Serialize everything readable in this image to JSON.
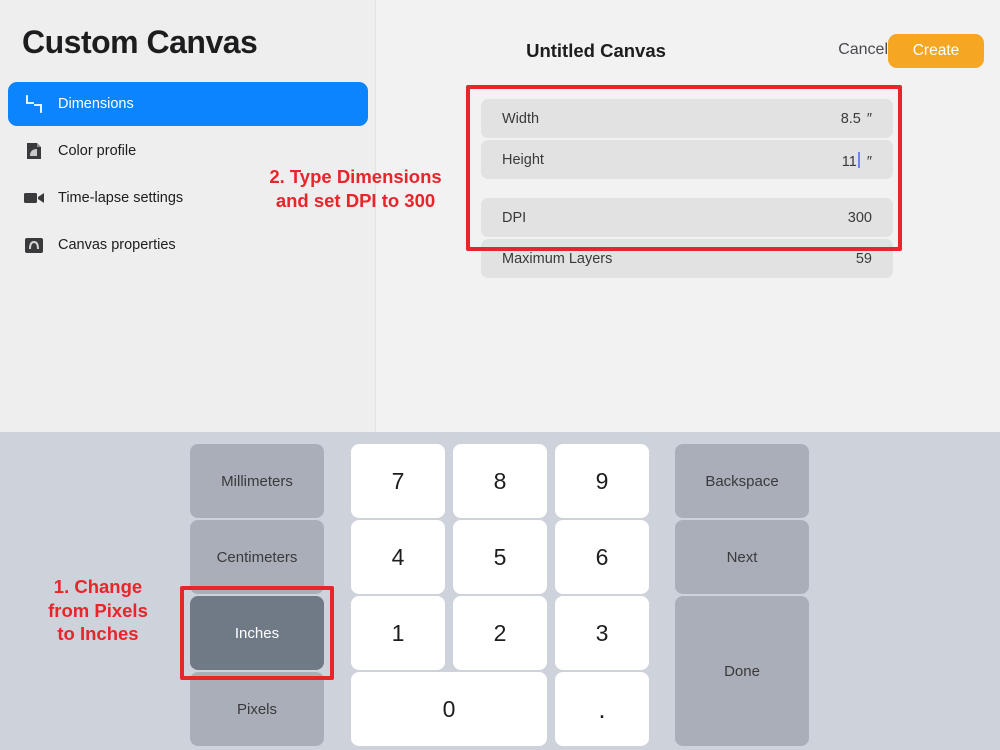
{
  "app": {
    "title": "Custom Canvas"
  },
  "sidebar": {
    "items": [
      {
        "label": "Dimensions",
        "icon": "crop-resize-icon",
        "active": true
      },
      {
        "label": "Color profile",
        "icon": "color-profile-icon",
        "active": false
      },
      {
        "label": "Time-lapse settings",
        "icon": "video-camera-icon",
        "active": false
      },
      {
        "label": "Canvas properties",
        "icon": "canvas-properties-icon",
        "active": false
      }
    ]
  },
  "header": {
    "canvas_title": "Untitled Canvas",
    "cancel_label": "Cancel",
    "create_label": "Create",
    "create_color": "#f5a623"
  },
  "fields": {
    "width": {
      "label": "Width",
      "value": "8.5",
      "unit": "″"
    },
    "height": {
      "label": "Height",
      "value": "11",
      "unit": "″",
      "caret": true
    },
    "dpi": {
      "label": "DPI",
      "value": "300",
      "unit": ""
    },
    "layers": {
      "label": "Maximum Layers",
      "value": "59",
      "unit": ""
    }
  },
  "annotations": {
    "step1": "1. Change\nfrom Pixels\nto Inches",
    "step2": "2. Type Dimensions\nand set DPI to 300",
    "highlight_color": "#e8252a"
  },
  "keyboard": {
    "units": [
      {
        "label": "Millimeters",
        "selected": false
      },
      {
        "label": "Centimeters",
        "selected": false
      },
      {
        "label": "Inches",
        "selected": true
      },
      {
        "label": "Pixels",
        "selected": false
      }
    ],
    "digits": [
      "7",
      "8",
      "9",
      "4",
      "5",
      "6",
      "1",
      "2",
      "3"
    ],
    "zero_label": "0",
    "decimal_label": ".",
    "backspace_label": "Backspace",
    "next_label": "Next",
    "done_label": "Done"
  }
}
